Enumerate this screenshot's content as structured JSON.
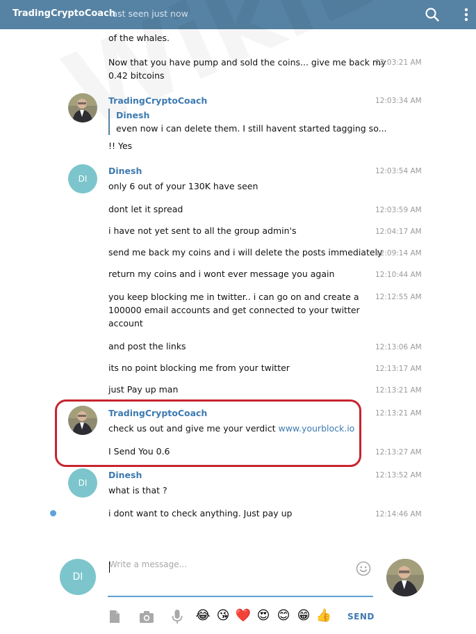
{
  "header": {
    "title": "TradingCryptoCoach",
    "status": "last seen just now"
  },
  "watermark": {
    "text": "WikiBit"
  },
  "messages": [
    {
      "text": "of the whales.",
      "time": ""
    },
    {
      "text_lines": [
        "Now that you have pump and sold the coins... give me back my",
        "0.42 bitcoins"
      ],
      "time": "12:03:21 AM"
    },
    {
      "sender": "TradingCryptoCoach",
      "time": "12:03:34 AM",
      "reply": {
        "name": "Dinesh",
        "text": "even now i can delete them. I still havent started tagging so..."
      },
      "text": "!! Yes"
    },
    {
      "sender": "Dinesh",
      "avatar": "DI",
      "time": "12:03:54 AM",
      "text": "only 6 out of your 130K have seen"
    },
    {
      "text": "dont let it spread",
      "time": "12:03:59 AM"
    },
    {
      "text": "i have not yet sent to all the group admin's",
      "time": "12:04:17 AM"
    },
    {
      "text": "send me back my coins and i will delete the posts immediately",
      "time": "12:09:14 AM"
    },
    {
      "text": "return my coins and i wont ever message you again",
      "time": "12:10:44 AM"
    },
    {
      "text_lines": [
        "you keep blocking me in twitter.. i can go on and create a",
        "100000 email accounts and get connected to your twitter",
        "account"
      ],
      "time": "12:12:55 AM"
    },
    {
      "text": "and post the links",
      "time": "12:13:06 AM"
    },
    {
      "text": "its no point blocking me from your twitter",
      "time": "12:13:17 AM"
    },
    {
      "text": "just Pay up man",
      "time": "12:13:21 AM"
    },
    {
      "sender": "TradingCryptoCoach",
      "time": "12:13:21 AM",
      "text": "check us out and give me your verdict ",
      "link": "www.yourblock.io"
    },
    {
      "text": "I Send You 0.6",
      "time": "12:13:27 AM"
    },
    {
      "sender": "Dinesh",
      "avatar": "DI",
      "time": "12:13:52 AM",
      "text": "what is that ?"
    },
    {
      "text": "i dont want to check anything. Just pay up",
      "time": "12:14:46 AM"
    }
  ],
  "composer": {
    "avatar": "DI",
    "placeholder": "Write a message...",
    "send_label": "SEND",
    "emojis": [
      "😂",
      "😘",
      "❤️",
      "😍",
      "😊",
      "😁",
      "👍"
    ]
  },
  "icons": [
    "search-icon",
    "more-vertical-icon",
    "emoji-icon",
    "file-icon",
    "camera-icon",
    "microphone-icon"
  ],
  "colors": {
    "header": "#5682a3",
    "accent": "#3d7ab0",
    "highlight": "#c8242f",
    "avatar": "#7cc5cc"
  }
}
